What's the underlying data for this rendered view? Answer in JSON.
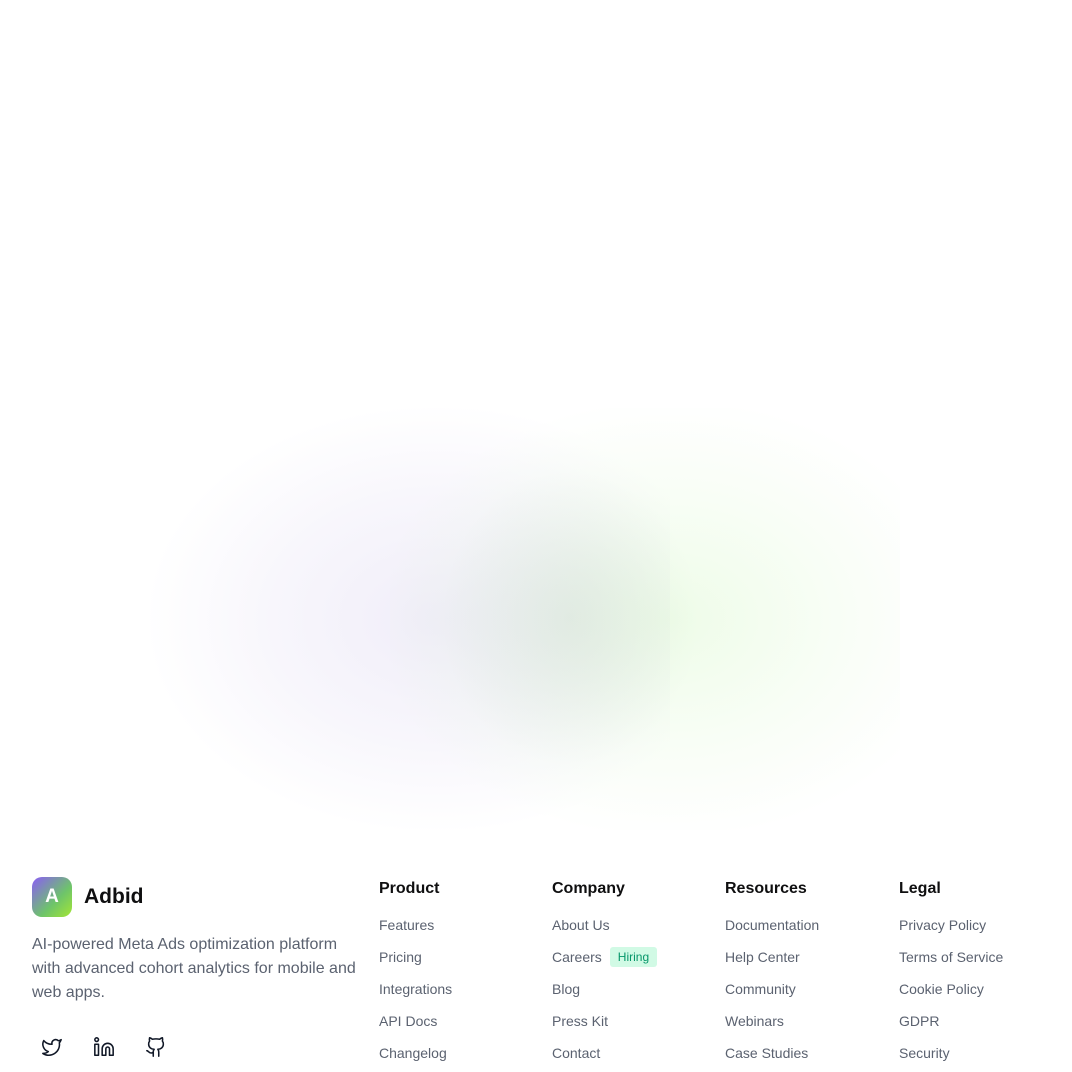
{
  "brand": {
    "logo_letter": "A",
    "name": "Adbid",
    "tagline": "AI-powered Meta Ads optimization platform with advanced cohort analytics for mobile and web apps."
  },
  "socials": [
    {
      "icon": "twitter-icon"
    },
    {
      "icon": "linkedin-icon"
    },
    {
      "icon": "github-icon"
    }
  ],
  "columns": [
    {
      "title": "Product",
      "links": [
        "Features",
        "Pricing",
        "Integrations",
        "API Docs",
        "Changelog"
      ]
    },
    {
      "title": "Company",
      "links": [
        "About Us",
        "Careers",
        "Blog",
        "Press Kit",
        "Contact"
      ],
      "badge": "Hiring"
    },
    {
      "title": "Resources",
      "links": [
        "Documentation",
        "Help Center",
        "Community",
        "Webinars",
        "Case Studies"
      ]
    },
    {
      "title": "Legal",
      "links": [
        "Privacy Policy",
        "Terms of Service",
        "Cookie Policy",
        "GDPR",
        "Security"
      ]
    }
  ],
  "colors": {
    "accent_purple": "#8b5cf6",
    "accent_green": "#a3e635",
    "badge_bg": "#d1fae5",
    "badge_text": "#059669",
    "muted_text": "#5b6270"
  }
}
